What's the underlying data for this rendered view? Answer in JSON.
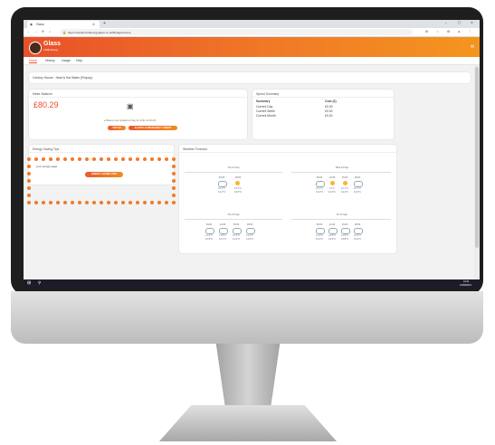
{
  "browser": {
    "tab_title": "Glass",
    "url": "https://resident.rfidenergyglass.co.uk/#!/pages/home"
  },
  "app": {
    "logo_text": "Glass",
    "logo_sub": "CARE Energy",
    "nav": [
      "Home",
      "History",
      "Usage",
      "Help"
    ],
    "property": "Century House - Heat & Hot Water (Prepay)"
  },
  "meter": {
    "title": "Meter Balance",
    "balance": "£80.29",
    "updated": "Balance last updated at Sep 20, 2021 10:00 AM",
    "topup_label": "TOP UP",
    "alerts_label": "ALERTS & EMERGENCY CREDIT"
  },
  "spend": {
    "title": "Spend Summary",
    "headers": [
      "Summary",
      "Cost (£)"
    ],
    "rows": [
      {
        "label": "Current Day",
        "cost": "£0.00"
      },
      {
        "label": "Current Week",
        "cost": "£0.00"
      },
      {
        "label": "Current Month",
        "cost": "£0.00"
      }
    ]
  },
  "tips": {
    "title": "Energy Saving Tips",
    "text": "your energy usage",
    "button_label": "ENERGY SAVING TIPS"
  },
  "weather": {
    "title": "Weather Forecast",
    "days": [
      {
        "label": "Tue 21 Sep",
        "slots": [
          {
            "time": "09:00",
            "hi": "15.2°C",
            "lo": "12.1°C",
            "icon": "cloud-icon"
          },
          {
            "time": "18:00",
            "hi": "15.3°C",
            "lo": "13.0°C",
            "icon": "sun-cloud-icon"
          }
        ]
      },
      {
        "label": "Wed 22 Sep",
        "slots": [
          {
            "time": "09:00",
            "hi": "15.1°C",
            "lo": "13.1°C",
            "icon": "cloud-icon"
          },
          {
            "time": "12:00",
            "hi": "16°C",
            "lo": "12.6°C",
            "icon": "sun-cloud-icon"
          },
          {
            "time": "15:00",
            "hi": "16.2°C",
            "lo": "14.2°C",
            "icon": "sun-cloud-icon"
          },
          {
            "time": "18:00",
            "hi": "15.1°C",
            "lo": "12.6°C",
            "icon": "cloud-icon"
          }
        ]
      },
      {
        "label": "Thu 23 Sep",
        "slots": [
          {
            "time": "09:00",
            "hi": "14.3°C",
            "lo": "14.3°C",
            "icon": "cloud-icon"
          },
          {
            "time": "12:00",
            "hi": "14.8°C",
            "lo": "12.1°C",
            "icon": "cloud-icon"
          },
          {
            "time": "15:00",
            "hi": "15.3°C",
            "lo": "14.2°C",
            "icon": "cloud-icon"
          },
          {
            "time": "18:00",
            "hi": "14.3°C",
            "lo": "14.3°C",
            "icon": "cloud-icon"
          }
        ]
      },
      {
        "label": "Fri 24 Sep",
        "slots": [
          {
            "time": "09:00",
            "hi": "14.3°C",
            "lo": "14.3°C",
            "icon": "cloud-icon"
          },
          {
            "time": "12:00",
            "hi": "13.8°C",
            "lo": "13.2°C",
            "icon": "cloud-icon"
          },
          {
            "time": "15:00",
            "hi": "14.8°C",
            "lo": "13.8°C",
            "icon": "cloud-icon"
          },
          {
            "time": "18:00",
            "hi": "13.3°C",
            "lo": "13.3°C",
            "icon": "cloud-icon"
          }
        ]
      }
    ]
  },
  "taskbar": {
    "time": "10:21",
    "date": "21/09/2021"
  },
  "colors": {
    "accent": "#f07a26",
    "brand_red": "#e8502a",
    "balance": "#e8502a"
  }
}
